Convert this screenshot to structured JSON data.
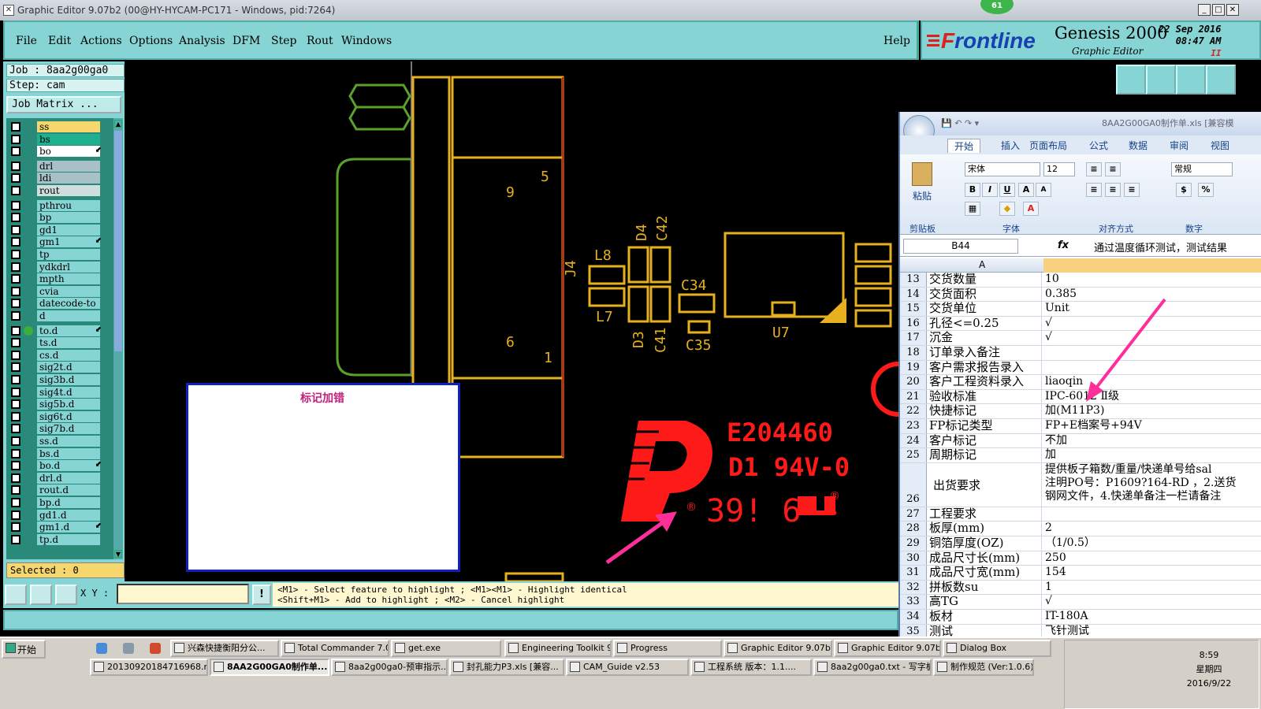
{
  "window": {
    "title": "Graphic Editor 9.07b2 (00@HY-HYCAM-PC171 - Windows, pid:7264)",
    "badge": "61",
    "min": "_",
    "max": "□",
    "close": "✕"
  },
  "menu": [
    "File",
    "Edit",
    "Actions",
    "Options",
    "Analysis",
    "DFM",
    "Step",
    "Rout",
    "Windows"
  ],
  "help": "Help",
  "brand": {
    "logo_f": "F",
    "logo_rest": "rontline",
    "product": "Genesis 2000",
    "sub": "Graphic Editor",
    "date": "22 Sep 2016",
    "time": "08:47 AM",
    "pause": "II"
  },
  "job": {
    "job_line": "Job : 8aa2g00ga0",
    "step_line": "Step: cam",
    "matrix_btn": "Job Matrix ..."
  },
  "layers": [
    {
      "name": "ss",
      "color": "#f5d76e",
      "arrow": ""
    },
    {
      "name": "bs",
      "color": "#1fb08f",
      "arrow": ""
    },
    {
      "name": "bo",
      "color": "#ffffff",
      "arrow": "⬋"
    },
    {
      "name": "drl",
      "color": "#a8c0c8",
      "arrow": ""
    },
    {
      "name": "ldi",
      "color": "#a8c0c8",
      "arrow": ""
    },
    {
      "name": "rout",
      "color": "#d0dede",
      "arrow": ""
    },
    {
      "name": "pthrou",
      "color": "#86d4d4",
      "arrow": ""
    },
    {
      "name": "bp",
      "color": "#86d4d4",
      "arrow": ""
    },
    {
      "name": "gd1",
      "color": "#86d4d4",
      "arrow": ""
    },
    {
      "name": "gm1",
      "color": "#86d4d4",
      "arrow": "⬋"
    },
    {
      "name": "tp",
      "color": "#86d4d4",
      "arrow": ""
    },
    {
      "name": "ydkdrl",
      "color": "#86d4d4",
      "arrow": ""
    },
    {
      "name": "mpth",
      "color": "#86d4d4",
      "arrow": ""
    },
    {
      "name": "cvia",
      "color": "#86d4d4",
      "arrow": ""
    },
    {
      "name": "datecode-to",
      "color": "#86d4d4",
      "arrow": ""
    },
    {
      "name": "d",
      "color": "#86d4d4",
      "arrow": ""
    },
    {
      "name": "to.d",
      "color": "#86d4d4",
      "arrow": "⬋"
    },
    {
      "name": "ts.d",
      "color": "#86d4d4",
      "arrow": ""
    },
    {
      "name": "cs.d",
      "color": "#86d4d4",
      "arrow": ""
    },
    {
      "name": "sig2t.d",
      "color": "#86d4d4",
      "arrow": ""
    },
    {
      "name": "sig3b.d",
      "color": "#86d4d4",
      "arrow": ""
    },
    {
      "name": "sig4t.d",
      "color": "#86d4d4",
      "arrow": ""
    },
    {
      "name": "sig5b.d",
      "color": "#86d4d4",
      "arrow": ""
    },
    {
      "name": "sig6t.d",
      "color": "#86d4d4",
      "arrow": ""
    },
    {
      "name": "sig7b.d",
      "color": "#86d4d4",
      "arrow": ""
    },
    {
      "name": "ss.d",
      "color": "#86d4d4",
      "arrow": ""
    },
    {
      "name": "bs.d",
      "color": "#86d4d4",
      "arrow": ""
    },
    {
      "name": "bo.d",
      "color": "#86d4d4",
      "arrow": "⬋"
    },
    {
      "name": "drl.d",
      "color": "#86d4d4",
      "arrow": ""
    },
    {
      "name": "rout.d",
      "color": "#86d4d4",
      "arrow": ""
    },
    {
      "name": "bp.d",
      "color": "#86d4d4",
      "arrow": ""
    },
    {
      "name": "gd1.d",
      "color": "#86d4d4",
      "arrow": ""
    },
    {
      "name": "gm1.d",
      "color": "#86d4d4",
      "arrow": "⬋"
    },
    {
      "name": "tp.d",
      "color": "#86d4d4",
      "arrow": ""
    }
  ],
  "selected": "Selected : 0",
  "xy_label": "X Y :",
  "info": "!",
  "hint": "<M1> - Select feature to highlight ; <M1><M1> - Highlight identical\n<Shift+M1> - Add to highlight ; <M2> - Cancel highlight",
  "note_title": "标记加错",
  "board": {
    "labels": {
      "n9": "9",
      "n5": "5",
      "n6": "6",
      "n1": "1",
      "j4": "J4",
      "l8": "L8",
      "l7": "L7",
      "d4": "D4",
      "c42": "C42",
      "d3": "D3",
      "c41": "C41",
      "c34": "C34",
      "c35": "C35",
      "u7": "U7"
    },
    "marking": {
      "e": "E204460",
      "d": "D1  94V-0",
      "r": "®",
      "code": "39! 6"
    }
  },
  "excel": {
    "title": "8AA2G00GA0制作单.xls [兼容模",
    "tabs": [
      "开始",
      "插入",
      "页面布局",
      "公式",
      "数据",
      "审阅",
      "视图"
    ],
    "font": "宋体",
    "size": "12",
    "numfmt": "常规",
    "groups": [
      "剪贴板",
      "字体",
      "对齐方式",
      "数字"
    ],
    "paste": "粘贴",
    "cell": "B44",
    "fx": "fx",
    "formula": "通过温度循环测试，测试结果",
    "col_a": "A",
    "rows": [
      {
        "n": "13",
        "a": "交货数量",
        "b": "10"
      },
      {
        "n": "14",
        "a": "交货面积",
        "b": "0.385"
      },
      {
        "n": "15",
        "a": "交货单位",
        "b": "Unit"
      },
      {
        "n": "16",
        "a": "孔径<=0.25",
        "b": "√"
      },
      {
        "n": "17",
        "a": "沉金",
        "b": "√"
      },
      {
        "n": "18",
        "a": "订单录入备注",
        "b": ""
      },
      {
        "n": "19",
        "a": "客户需求报告录入",
        "b": ""
      },
      {
        "n": "20",
        "a": "客户工程资料录入",
        "b": "liaoqin"
      },
      {
        "n": "21",
        "a": "验收标准",
        "b": "IPC-6012 Ⅱ级"
      },
      {
        "n": "22",
        "a": "快捷标记",
        "b": "加(M11P3)"
      },
      {
        "n": "23",
        "a": "FP标记类型",
        "b": "FP+E档案号+94V"
      },
      {
        "n": "24",
        "a": "客户标记",
        "b": "不加"
      },
      {
        "n": "25",
        "a": "周期标记",
        "b": "加"
      },
      {
        "n": "26",
        "a": "出货要求",
        "b": "提供板子箱数/重量/快递单号给sal\n注明PO号：P1609?164-RD ，2.送货\n钢网文件，4.快递单备注一栏请备注"
      },
      {
        "n": "27",
        "a": "工程要求",
        "b": ""
      },
      {
        "n": "28",
        "a": "板厚(mm)",
        "b": "2"
      },
      {
        "n": "29",
        "a": "铜箔厚度(OZ)",
        "b": "（1/0.5）"
      },
      {
        "n": "30",
        "a": "成品尺寸长(mm)",
        "b": "250"
      },
      {
        "n": "31",
        "a": "成品尺寸宽(mm)",
        "b": "154"
      },
      {
        "n": "32",
        "a": "拼板数su",
        "b": "1"
      },
      {
        "n": "33",
        "a": "高TG",
        "b": "√"
      },
      {
        "n": "34",
        "a": "板材",
        "b": "IT-180A"
      },
      {
        "n": "35",
        "a": "测试",
        "b": "飞针测试"
      }
    ]
  },
  "taskbar": {
    "start": "开始",
    "row1": [
      "兴森快捷衡阳分公...",
      "Total Commander 7.0...",
      "get.exe",
      "Engineering Toolkit 9....",
      "Progress",
      "Graphic Editor 9.07b...",
      "Graphic Editor 9.07b...",
      "Dialog Box"
    ],
    "row2": [
      "20130920184716968.rt...",
      "8AA2G00GA0制作单....",
      "8aa2g00ga0-预审指示...",
      "封孔能力P3.xls [兼容...",
      "CAM_Guide v2.53",
      "工程系统  版本：1.1....",
      "8aa2g00ga0.txt - 写字板",
      "制作规范 (Ver:1.0.6)"
    ],
    "time": "8:59",
    "weekday": "星期四",
    "date": "2016/9/22"
  },
  "colors": {
    "panel": "#86d4d4",
    "copper": "#e6b020",
    "outline": "#5aa02a",
    "marking": "#ff1a1a",
    "arrow": "#ff2f9a"
  }
}
